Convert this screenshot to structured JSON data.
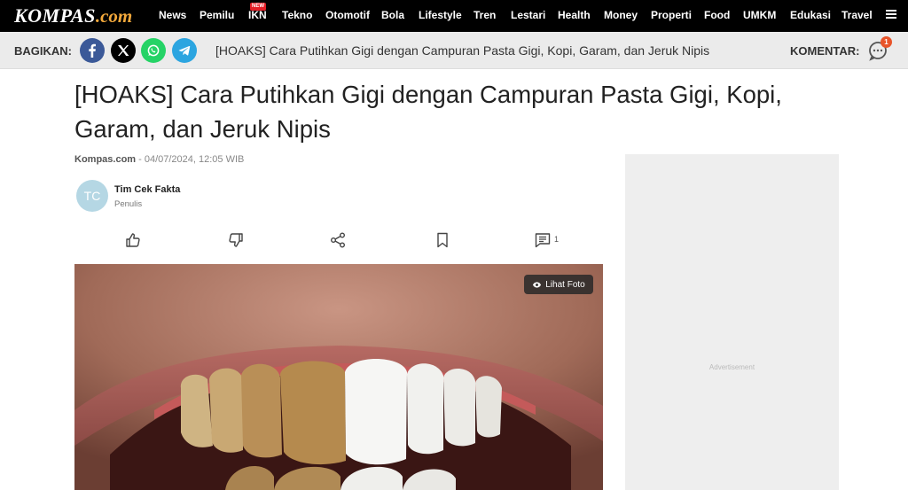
{
  "header": {
    "logo_main": "KOMPAS",
    "logo_suffix": ".com",
    "nav_items": [
      "News",
      "Pemilu",
      "IKN",
      "Tekno",
      "Otomotif",
      "Bola",
      "Lifestyle",
      "Tren",
      "Lestari",
      "Health",
      "Money",
      "Properti",
      "Food",
      "UMKM",
      "Edukasi",
      "Travel"
    ],
    "new_badge": "NEW"
  },
  "sharebar": {
    "label": "BAGIKAN:",
    "title": "[HOAKS] Cara Putihkan Gigi dengan Campuran Pasta Gigi, Kopi, Garam, dan Jeruk Nipis",
    "comment_label": "KOMENTAR:",
    "comment_count": "1"
  },
  "article": {
    "headline": "[HOAKS] Cara Putihkan Gigi dengan Campuran Pasta Gigi, Kopi, Garam, dan Jeruk Nipis",
    "source": "Kompas.com",
    "date": " - 04/07/2024, 12:05 WIB",
    "author_initials": "TC",
    "author_name": "Tim Cek Fakta",
    "author_role": "Penulis",
    "comments_count": "1",
    "photo_button": "Lihat Foto"
  },
  "ad": {
    "label": "Advertisement"
  },
  "colors": {
    "facebook": "#3b5998",
    "x": "#000000",
    "whatsapp": "#25d366",
    "telegram": "#2ca5e0",
    "logo_accent": "#f2a83b",
    "badge": "#e41e26"
  }
}
